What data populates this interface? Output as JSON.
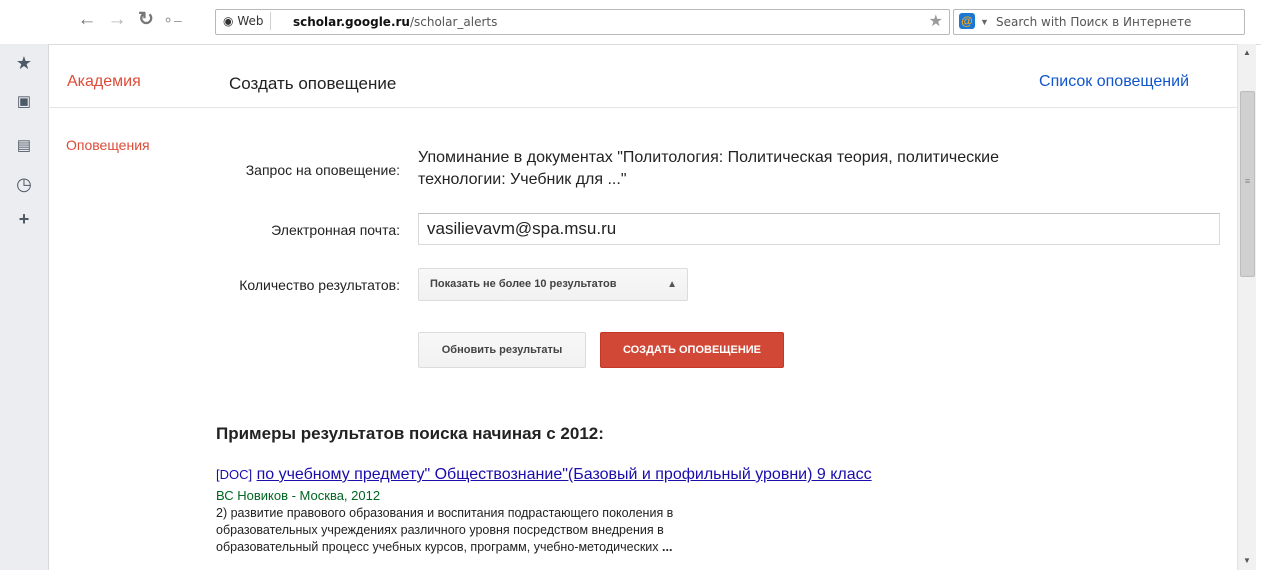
{
  "browser": {
    "search_chip": "Web",
    "url_domain": "scholar.google.ru",
    "url_path": "/scholar_alerts",
    "search_placeholder": "Search with Поиск в Интернете"
  },
  "header": {
    "brand": "Академия",
    "title": "Создать оповещение",
    "alerts_list_link": "Список оповещений"
  },
  "sidebar": {
    "alerts_label": "Оповещения"
  },
  "form": {
    "query_label": "Запрос на оповещение:",
    "query_line1": "Упоминание в документах \"Политология: Политическая теория, политические",
    "query_line2": "технологии: Учебник для ...\"",
    "email_label": "Электронная почта:",
    "email_value": "vasilievavm@spa.msu.ru",
    "count_label": "Количество результатов:",
    "count_value": "Показать не более 10 результатов",
    "update_button": "Обновить результаты",
    "create_button": "СОЗДАТЬ ОПОВЕЩЕНИЕ"
  },
  "examples": {
    "heading": "Примеры результатов поиска начиная с 2012:",
    "results": [
      {
        "tag": "[DOC]",
        "title": "по учебному предмету\" Обществознание\"(Базовый и профильный уровни) 9 класс",
        "meta": "ВС Новиков - Москва, 2012",
        "snippet_line1": "2) развитие правового образования и воспитания подрастающего поколения в",
        "snippet_line2": "образовательных учреждениях различного уровня посредством внедрения в",
        "snippet_line3": "образовательный процесс учебных курсов, программ, учебно-методических",
        "snippet_ellipsis": "..."
      }
    ]
  },
  "colors": {
    "brand_red": "#dd4b39",
    "link_blue": "#1155cc",
    "result_link": "#1a0dab",
    "meta_green": "#006621",
    "create_button": "#d14836"
  }
}
